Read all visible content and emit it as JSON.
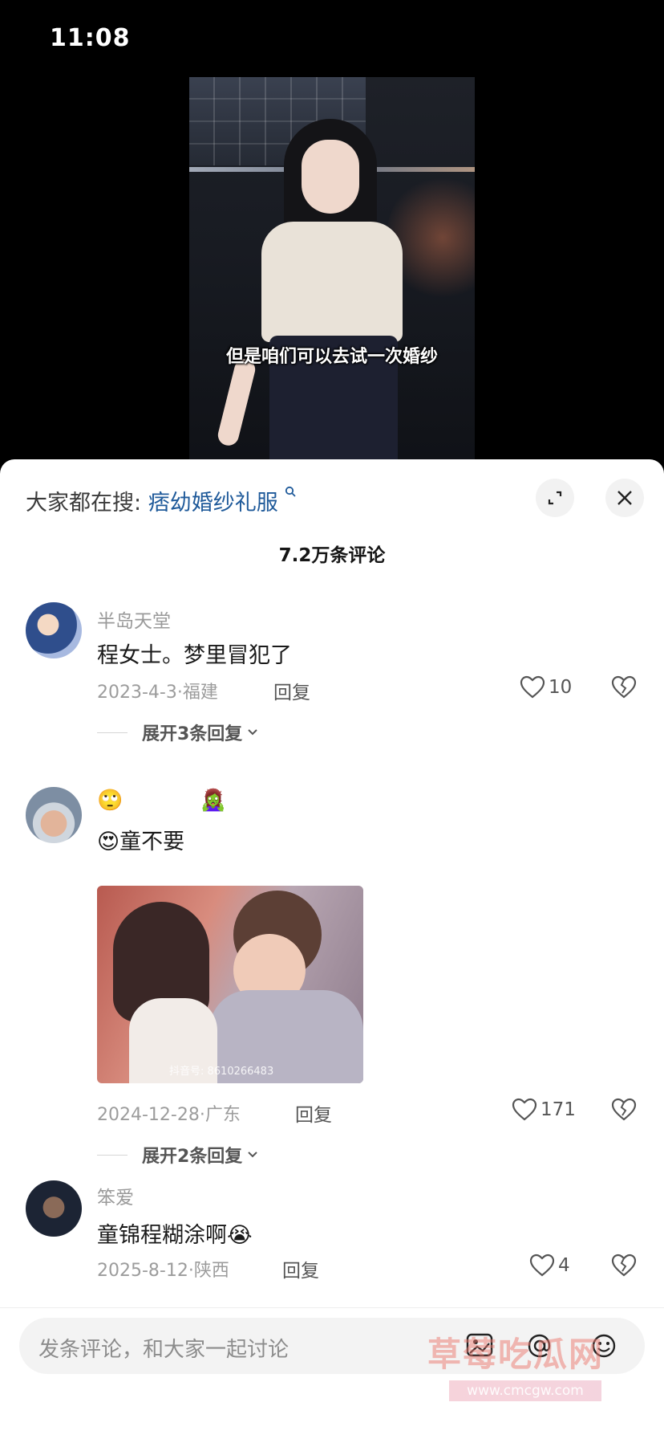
{
  "status_bar": {
    "time": "11:08"
  },
  "video": {
    "subtitle": "但是咱们可以去试一次婚纱"
  },
  "panel": {
    "search_prefix": "大家都在搜:",
    "search_term": "痞幼婚纱礼服",
    "comment_count": "7.2万条评论"
  },
  "comments": [
    {
      "username": "半岛天堂",
      "text": "程女士。梦里冒犯了",
      "date_location": "2023-4-3·福建",
      "reply_label": "回复",
      "likes": "10",
      "expand": "展开3条回复"
    },
    {
      "username_emoji": "🙄 🧟‍♀️",
      "text_emoji": "😍",
      "text": "童不要",
      "image_caption": "抖音号: 8610266483",
      "date_location": "2024-12-28·广东",
      "reply_label": "回复",
      "likes": "171",
      "expand": "展开2条回复"
    },
    {
      "username": "笨爱",
      "text": "童锦程糊涂啊",
      "text_emoji": "😭",
      "date_location": "2025-8-12·陕西",
      "reply_label": "回复",
      "likes": "4"
    }
  ],
  "bottom_bar": {
    "input_placeholder": "发条评论，和大家一起讨论",
    "watermark": "草莓吃瓜网",
    "watermark_url": "www.cmcgw.com"
  },
  "icons": [
    "expand-icon",
    "close-icon",
    "heart-icon",
    "broken-heart-icon",
    "chevron-down-icon",
    "image-icon",
    "at-icon",
    "emoji-icon"
  ]
}
